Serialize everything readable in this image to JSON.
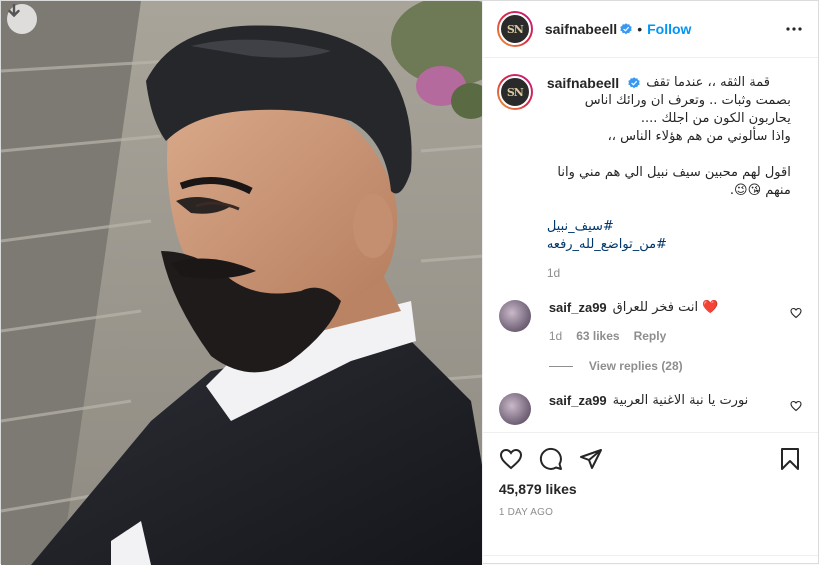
{
  "post": {
    "username": "saifnabeell",
    "follow_label": "Follow",
    "avatar_text": "SN",
    "caption": {
      "lines": [
        "قمة الثقه ،، عندما تقف",
        "بصمت وثبات .. وتعرف ان ورائك اناس",
        "يحاربون الكون من اجلك ....",
        "واذا سألوني من هم هؤلاء الناس ،،"
      ],
      "lines2": [
        "اقول لهم محبين سيف نبيل الي هم مني وانا",
        "منهم 😘😉."
      ],
      "hashtags": [
        "#سيف_نبيل",
        "#من_تواضع_لله_رفعه"
      ],
      "time": "1d"
    },
    "comments": [
      {
        "username": "saif_za99",
        "text": "انت فخر للعراق ❤️",
        "time": "1d",
        "likes": "63 likes",
        "reply_label": "Reply",
        "view_replies": "View replies (28)"
      },
      {
        "username": "saif_za99",
        "text": "نورت يا نبة الاغنية العربية"
      }
    ],
    "likes": "45,879 likes",
    "date": "1 DAY AGO"
  },
  "icons": {
    "download": "download-icon",
    "verified": "verified-badge-icon",
    "more": "more-options-icon",
    "like": "heart-icon",
    "comment": "comment-icon",
    "share": "share-icon",
    "save": "bookmark-icon"
  },
  "colors": {
    "accent": "#0095f6",
    "verified": "#3897f0",
    "secondary_text": "#8e8e8e",
    "hashtag": "#00376b",
    "heart_red": "#ed4956"
  }
}
